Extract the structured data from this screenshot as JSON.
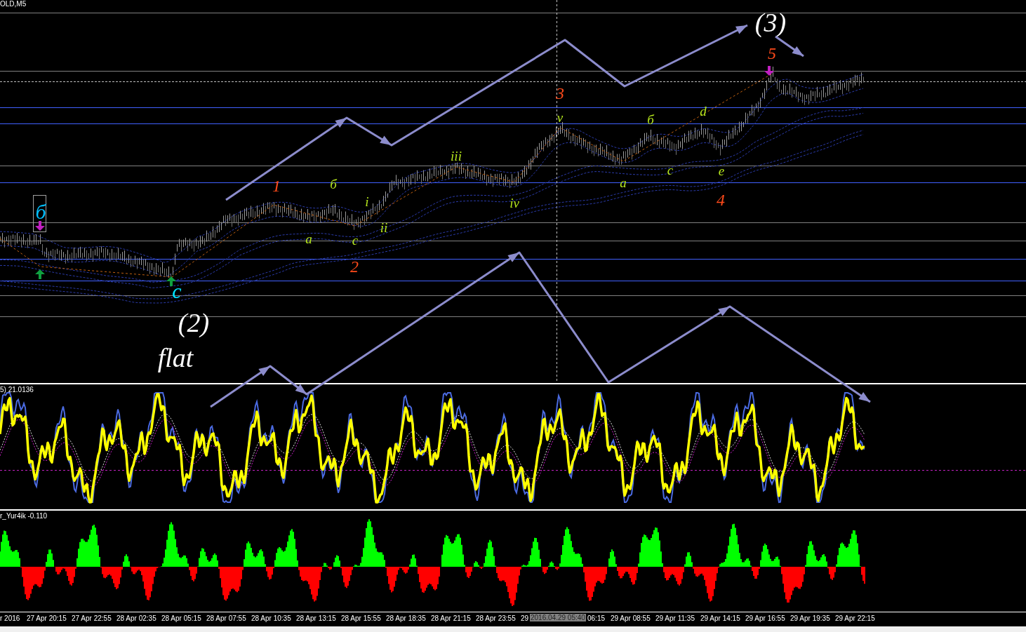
{
  "chart": {
    "title": "OLD,M5",
    "wave_labels": [
      {
        "text": "(3)",
        "kind": "cycle",
        "color": "#ffffff"
      },
      {
        "text": "5",
        "kind": "primary",
        "color": "#ff4a1a"
      },
      {
        "text": "3",
        "kind": "primary",
        "color": "#ff4a1a"
      },
      {
        "text": "v",
        "kind": "minor",
        "color": "#b5e61d"
      },
      {
        "text": "б",
        "kind": "minor",
        "color": "#b5e61d"
      },
      {
        "text": "d",
        "kind": "minor",
        "color": "#b5e61d"
      },
      {
        "text": "iii",
        "kind": "minor",
        "color": "#b5e61d"
      },
      {
        "text": "c",
        "kind": "minor",
        "color": "#b5e61d"
      },
      {
        "text": "e",
        "kind": "minor",
        "color": "#b5e61d"
      },
      {
        "text": "1",
        "kind": "primary",
        "color": "#ff4a1a"
      },
      {
        "text": "б",
        "kind": "minor",
        "color": "#b5e61d"
      },
      {
        "text": "a",
        "kind": "minor",
        "color": "#b5e61d"
      },
      {
        "text": "i",
        "kind": "minor",
        "color": "#b5e61d"
      },
      {
        "text": "iv",
        "kind": "minor",
        "color": "#b5e61d"
      },
      {
        "text": "4",
        "kind": "primary",
        "color": "#ff4a1a"
      },
      {
        "text": "б",
        "kind": "intermediate",
        "color": "#00bfff"
      },
      {
        "text": "ii",
        "kind": "minor",
        "color": "#b5e61d"
      },
      {
        "text": "a",
        "kind": "minor",
        "color": "#b5e61d"
      },
      {
        "text": "c",
        "kind": "minor",
        "color": "#b5e61d"
      },
      {
        "text": "2",
        "kind": "primary",
        "color": "#ff4a1a"
      },
      {
        "text": "c",
        "kind": "intermediate",
        "color": "#00e5ff"
      },
      {
        "text": "(2)",
        "kind": "cycle",
        "color": "#ffffff"
      },
      {
        "text": "flat",
        "kind": "cycle",
        "color": "#ffffff"
      }
    ]
  },
  "oscillator": {
    "label": "5) 21.0136"
  },
  "histogram": {
    "label": "r_Yur4ik -0.110"
  },
  "time_axis": {
    "labels": [
      "r 2016",
      "27 Apr 20:15",
      "27 Apr 22:55",
      "28 Apr 02:35",
      "28 Apr 05:15",
      "28 Apr 07:55",
      "28 Apr 10:35",
      "28 Apr 13:15",
      "28 Apr 15:55",
      "28 Apr 18:35",
      "28 Apr 21:15",
      "28 Apr 23:55",
      "29",
      "06:15",
      "29 Apr 08:55",
      "29 Apr 11:35",
      "29 Apr 14:15",
      "29 Apr 16:55",
      "29 Apr 19:35",
      "29 Apr 22:15"
    ],
    "cursor_label": "2016.04.29 05:40"
  }
}
